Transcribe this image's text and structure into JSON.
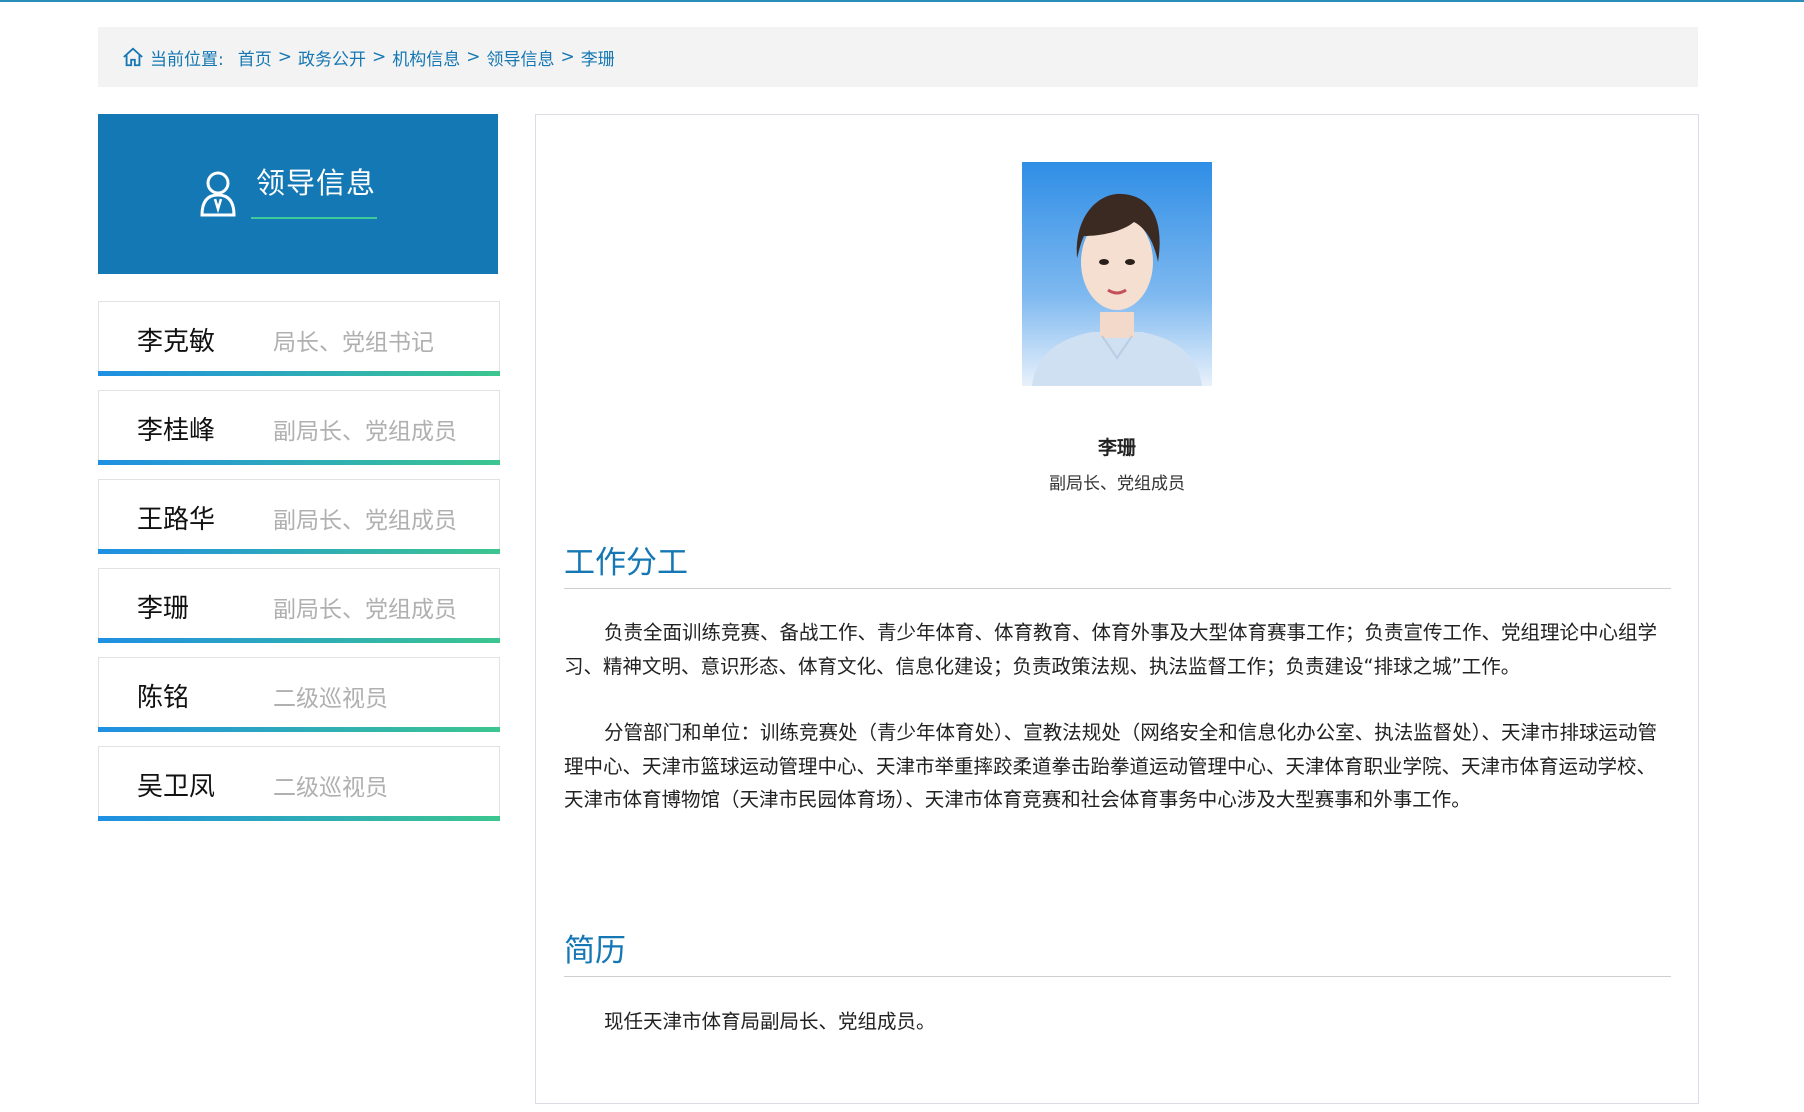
{
  "breadcrumb": {
    "label": "当前位置:",
    "items": [
      "首页",
      "政务公开",
      "机构信息",
      "领导信息",
      "李珊"
    ],
    "separator": ">"
  },
  "sidebar": {
    "title": "领导信息",
    "leaders": [
      {
        "name": "李克敏",
        "role": "局长、党组书记"
      },
      {
        "name": "李桂峰",
        "role": "副局长、党组成员"
      },
      {
        "name": "王路华",
        "role": "副局长、党组成员"
      },
      {
        "name": "李珊",
        "role": "副局长、党组成员"
      },
      {
        "name": "陈铭",
        "role": "二级巡视员"
      },
      {
        "name": "吴卫凤",
        "role": "二级巡视员"
      }
    ]
  },
  "profile": {
    "name": "李珊",
    "title": "副局长、党组成员",
    "duties_heading": "工作分工",
    "duties_p1": "负责全面训练竞赛、备战工作、青少年体育、体育教育、体育外事及大型体育赛事工作；负责宣传工作、党组理论中心组学习、精神文明、意识形态、体育文化、信息化建设；负责政策法规、执法监督工作；负责建设“排球之城”工作。",
    "duties_p2": "分管部门和单位：训练竞赛处（青少年体育处）、宣教法规处（网络安全和信息化办公室、执法监督处）、天津市排球运动管理中心、天津市篮球运动管理中心、天津市举重摔跤柔道拳击跆拳道运动管理中心、天津体育职业学院、天津市体育运动学校、天津市体育博物馆（天津市民园体育场）、天津市体育竞赛和社会体育事务中心涉及大型赛事和外事工作。",
    "resume_heading": "简历",
    "resume_text": "现任天津市体育局副局长、党组成员。"
  },
  "colors": {
    "accent": "#1378b4",
    "link": "#1577b3",
    "bar_start": "#1f8fe3",
    "bar_end": "#3cc68f"
  }
}
